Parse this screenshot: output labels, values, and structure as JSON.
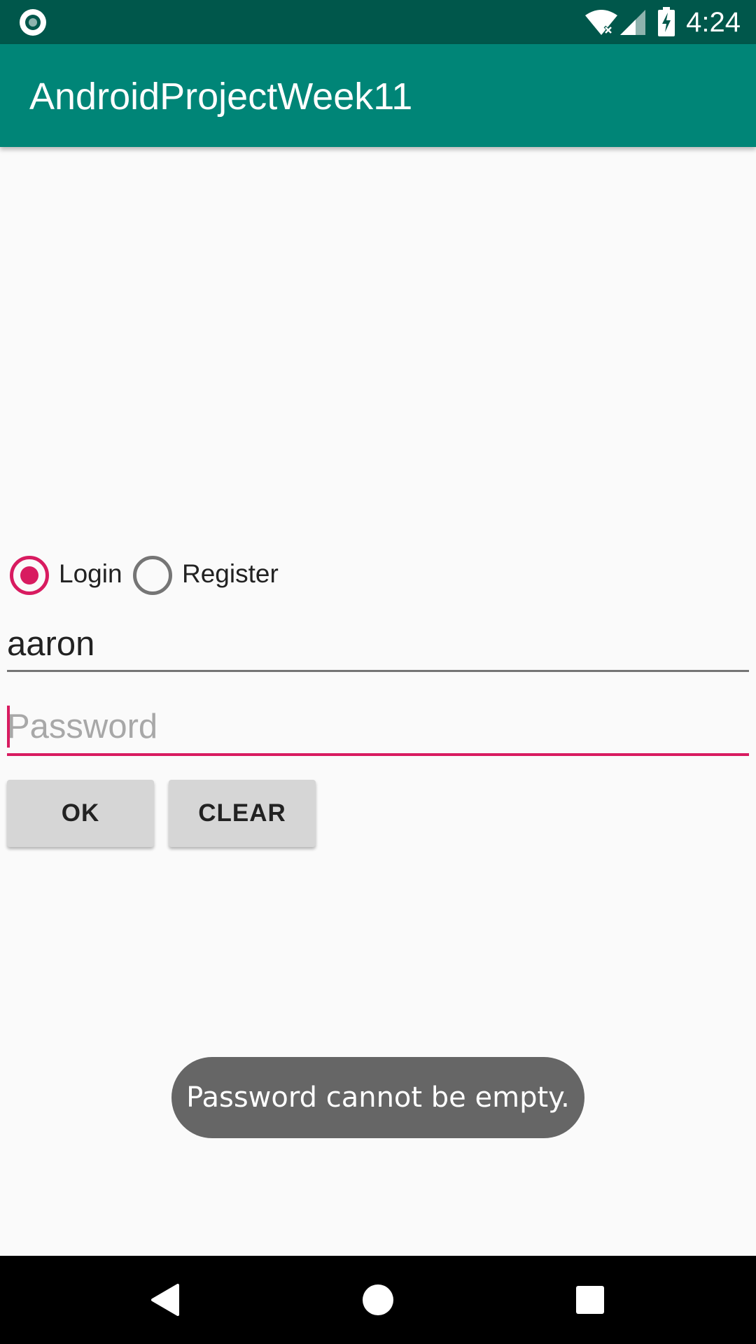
{
  "status_bar": {
    "time": "4:24",
    "icons": [
      "record-icon",
      "wifi-icon",
      "signal-icon",
      "battery-charging-icon"
    ]
  },
  "app_bar": {
    "title": "AndroidProjectWeek11"
  },
  "form": {
    "mode_options": [
      {
        "label": "Login",
        "checked": true
      },
      {
        "label": "Register",
        "checked": false
      }
    ],
    "username_value": "aaron",
    "password_placeholder": "Password",
    "password_value": "",
    "ok_label": "OK",
    "clear_label": "CLEAR"
  },
  "toast": {
    "message": "Password cannot be empty."
  },
  "nav_bar": {
    "icons": [
      "back-icon",
      "home-icon",
      "recents-icon"
    ]
  },
  "colors": {
    "status_bar": "#00574b",
    "primary": "#008577",
    "accent": "#d81b60",
    "background": "#fafafa",
    "button": "#d6d6d6",
    "toast": "#666666"
  }
}
